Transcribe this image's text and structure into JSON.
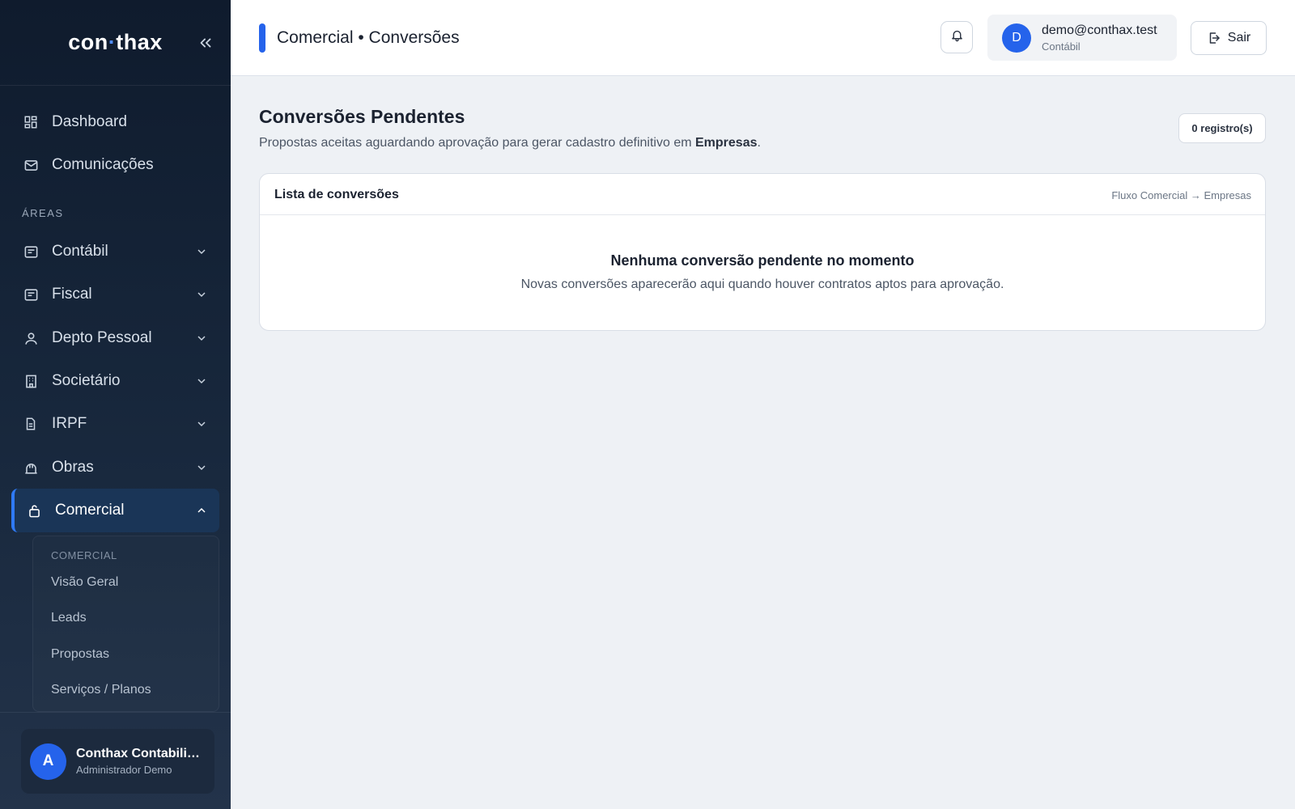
{
  "brand": {
    "prefix": "con",
    "dot": "·",
    "suffix": "thax"
  },
  "sidebar": {
    "items_top": [
      {
        "label": "Dashboard",
        "icon": "dashboard-icon"
      },
      {
        "label": "Comunicações",
        "icon": "mail-icon"
      }
    ],
    "section_label": "ÁREAS",
    "areas": [
      {
        "label": "Contábil",
        "icon": "ledger-icon"
      },
      {
        "label": "Fiscal",
        "icon": "ledger-icon"
      },
      {
        "label": "Depto Pessoal",
        "icon": "person-icon"
      },
      {
        "label": "Societário",
        "icon": "building-icon"
      },
      {
        "label": "IRPF",
        "icon": "document-icon"
      },
      {
        "label": "Obras",
        "icon": "construction-icon"
      },
      {
        "label": "Comercial",
        "icon": "bag-icon",
        "active": true
      }
    ],
    "submenu": {
      "title": "COMERCIAL",
      "items": [
        "Visão Geral",
        "Leads",
        "Propostas",
        "Serviços / Planos"
      ]
    },
    "user": {
      "initial": "A",
      "name": "Conthax Contabilidade",
      "role": "Administrador Demo"
    }
  },
  "topbar": {
    "breadcrumb": "Comercial • Conversões",
    "account": {
      "initial": "D",
      "email": "demo@conthax.test",
      "role": "Contábil"
    },
    "logout_label": "Sair"
  },
  "main": {
    "title": "Conversões Pendentes",
    "subtitle_prefix": "Propostas aceitas aguardando aprovação para gerar cadastro definitivo em ",
    "subtitle_bold": "Empresas",
    "subtitle_suffix": ".",
    "count_badge": "0 registro(s)",
    "list": {
      "title": "Lista de conversões",
      "flow": "Fluxo Comercial → Empresas",
      "empty_title": "Nenhuma conversão pendente no momento",
      "empty_sub": "Novas conversões aparecerão aqui quando houver contratos aptos para aprovação."
    }
  },
  "colors": {
    "accent": "#2563eb",
    "sidebar_bg": "#0f1b2d",
    "page_bg": "#eef1f5"
  }
}
